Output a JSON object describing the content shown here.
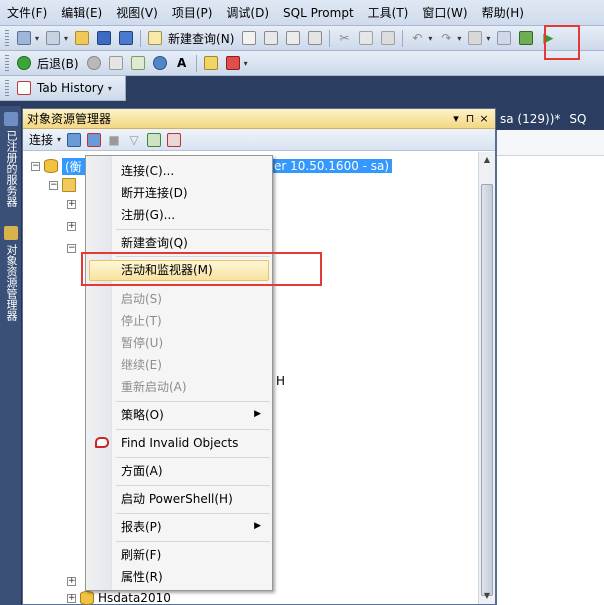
{
  "menubar": {
    "items": [
      "文件(F)",
      "编辑(E)",
      "视图(V)",
      "项目(P)",
      "调试(D)",
      "SQL Prompt",
      "工具(T)",
      "窗口(W)",
      "帮助(H)"
    ]
  },
  "toolbar1": {
    "new_query_label": "新建查询(N)"
  },
  "toolbar2": {
    "back_label": "后退(B)",
    "font_glyph": "A"
  },
  "toolbar3": {
    "tab_history_label": "Tab History"
  },
  "side_tabs": [
    "已注册的服务器",
    "对象资源管理器"
  ],
  "object_explorer": {
    "title": "对象资源管理器",
    "pin_glyph": "▾ ⊓",
    "close_glyph": "×",
    "connect_label": "连接",
    "tree": {
      "root_label_start": "(",
      "root_label_prefix": "(衡",
      "root_label_suffix": "er 10.50.1600 - sa)",
      "partial_text": "H",
      "last_node_label": "Hsdata2010"
    }
  },
  "document": {
    "tab_label": "sa (129))*",
    "tab2_label": "SQ"
  },
  "context_menu": {
    "items": [
      {
        "label": "连接(C)...",
        "enabled": true
      },
      {
        "label": "断开连接(D)",
        "enabled": true
      },
      {
        "label": "注册(G)...",
        "enabled": true
      },
      {
        "label": "新建查询(Q)",
        "enabled": true
      },
      {
        "label": "活动和监视器(M)",
        "enabled": true,
        "highlighted": true
      },
      {
        "label": "启动(S)",
        "enabled": false
      },
      {
        "label": "停止(T)",
        "enabled": false
      },
      {
        "label": "暂停(U)",
        "enabled": false
      },
      {
        "label": "继续(E)",
        "enabled": false
      },
      {
        "label": "重新启动(A)",
        "enabled": false
      },
      {
        "label": "策略(O)",
        "enabled": true,
        "submenu": true
      },
      {
        "label": "Find Invalid Objects",
        "enabled": true,
        "icon": "sql-prompt-icon"
      },
      {
        "label": "方面(A)",
        "enabled": true
      },
      {
        "label": "启动 PowerShell(H)",
        "enabled": true
      },
      {
        "label": "报表(P)",
        "enabled": true,
        "submenu": true
      },
      {
        "label": "刷新(F)",
        "enabled": true
      },
      {
        "label": "属性(R)",
        "enabled": true
      }
    ]
  },
  "colors": {
    "highlight_box": "#e53935",
    "selection": "#3399ff",
    "panel_title": "#f3d784"
  }
}
